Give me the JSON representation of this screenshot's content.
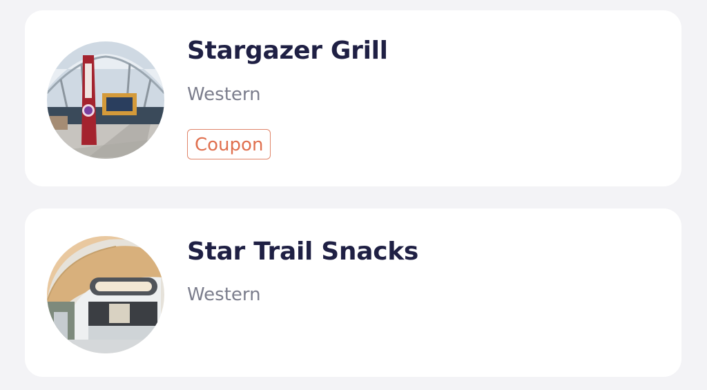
{
  "restaurants": [
    {
      "name": "Stargazer Grill",
      "category": "Western",
      "badge": "Coupon",
      "thumbnail_icon": "restaurant-photo-stargazer-grill"
    },
    {
      "name": "Star Trail Snacks",
      "category": "Western",
      "thumbnail_icon": "restaurant-photo-star-trail-snacks"
    }
  ],
  "colors": {
    "background": "#f3f3f6",
    "card": "#ffffff",
    "title": "#1f2044",
    "category": "#7b7d8c",
    "badge": "#e0704f"
  }
}
